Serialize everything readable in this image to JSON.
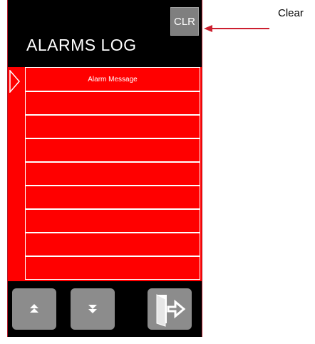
{
  "header": {
    "title": "ALARMS LOG",
    "clear_button_label": "CLR"
  },
  "alarm_list": {
    "column_header": "Alarm Message",
    "rows": [
      "",
      "",
      "",
      "",
      "",
      "",
      "",
      ""
    ]
  },
  "callout": {
    "label": "Clear"
  },
  "nav": {
    "up_icon": "double-chevron-up-icon",
    "down_icon": "double-chevron-down-icon",
    "exit_icon": "exit-door-icon"
  },
  "colors": {
    "panel_background": "#000000",
    "list_background": "#ff0000",
    "button_gray": "#8c8c8c",
    "callout_arrow": "#cc1f2f"
  }
}
